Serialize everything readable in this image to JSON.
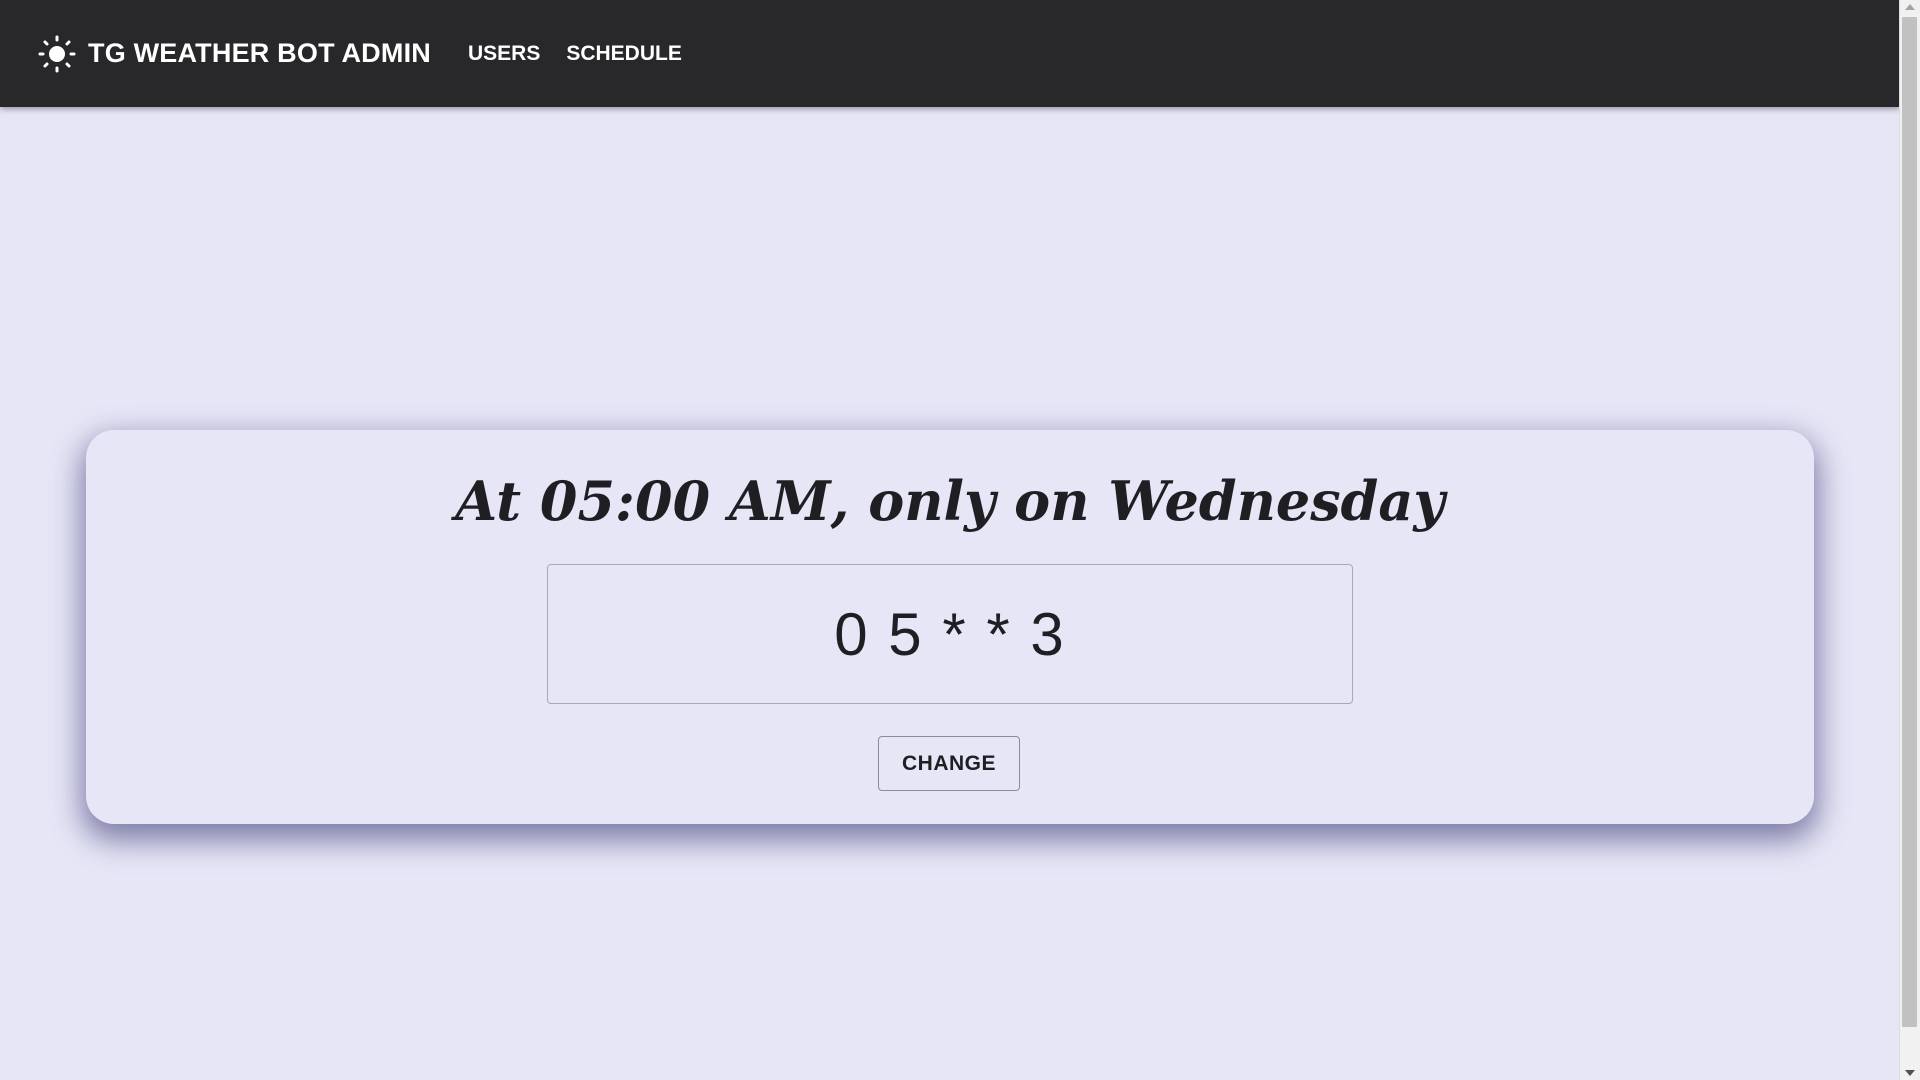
{
  "app": {
    "title": "TG WEATHER BOT ADMIN",
    "logo_icon": "sun-icon"
  },
  "nav": {
    "items": [
      {
        "label": "USERS"
      },
      {
        "label": "SCHEDULE"
      }
    ]
  },
  "schedule": {
    "description": "At 05:00 AM, only on Wednesday",
    "cron_value": "0 5 * * 3",
    "change_label": "CHANGE"
  },
  "colors": {
    "appbar": "#28282b",
    "background": "#e6e6f6",
    "text": "#1f1f23"
  }
}
